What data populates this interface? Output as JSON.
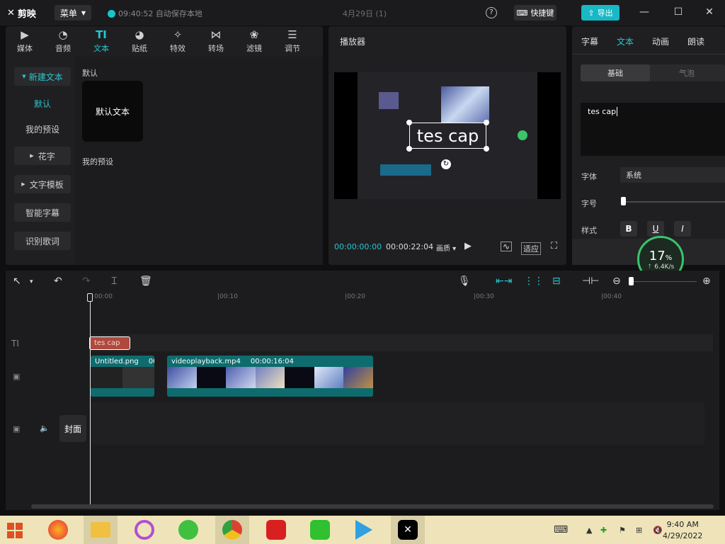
{
  "app": {
    "name": "剪映",
    "menu_label": "菜单",
    "autosave": "09:40:52 自动保存本地",
    "project_title": "4月29日 (1)",
    "shortcut_label": "快捷键",
    "export_label": "导出"
  },
  "tools": [
    {
      "label": "媒体",
      "icon": "media-icon"
    },
    {
      "label": "音频",
      "icon": "audio-icon"
    },
    {
      "label": "文本",
      "icon": "text-icon",
      "active": true
    },
    {
      "label": "贴纸",
      "icon": "sticker-icon"
    },
    {
      "label": "特效",
      "icon": "effects-icon"
    },
    {
      "label": "转场",
      "icon": "transition-icon"
    },
    {
      "label": "滤镜",
      "icon": "filter-icon"
    },
    {
      "label": "调节",
      "icon": "adjust-icon"
    }
  ],
  "sidebar": {
    "new_text": "新建文本",
    "default": "默认",
    "my_presets": "我的预设",
    "fancy_text": "花字",
    "text_template": "文字模板",
    "smart_caption": "智能字幕",
    "lyrics": "识别歌词"
  },
  "content": {
    "section_default": "默认",
    "default_card": "默认文本",
    "section_presets": "我的预设"
  },
  "player": {
    "title": "播放器",
    "caption_text": "tes cap",
    "current_time": "00:00:00:00",
    "total_time": "00:00:22:04",
    "quality": "画质",
    "fit": "适应"
  },
  "inspector": {
    "tabs": [
      "字幕",
      "文本",
      "动画",
      "朗读"
    ],
    "segments": [
      "基础",
      "气泡"
    ],
    "text_value": "tes cap",
    "font_label": "字体",
    "font_value": "系统",
    "size_label": "字号",
    "style_label": "样式",
    "bold": "B",
    "underline": "U",
    "italic": "I"
  },
  "speed_widget": {
    "percent": "17",
    "percent_sign": "%",
    "rate": "6.4K/s"
  },
  "timeline": {
    "ticks": [
      "00:00",
      "|00:10",
      "|00:20",
      "|00:30",
      "|00:40"
    ],
    "caption_clip": "tes cap",
    "clip1_name": "Untitled.png",
    "clip1_dur": "00",
    "clip2_name": "videoplayback.mp4",
    "clip2_dur": "00:00:16:04",
    "cover": "封面"
  },
  "taskbar": {
    "time": "9:40 AM",
    "date": "4/29/2022"
  },
  "colors": {
    "accent": "#28c7cf",
    "caption_clip": "#b0483c",
    "video_clip": "#0e6c6e"
  }
}
